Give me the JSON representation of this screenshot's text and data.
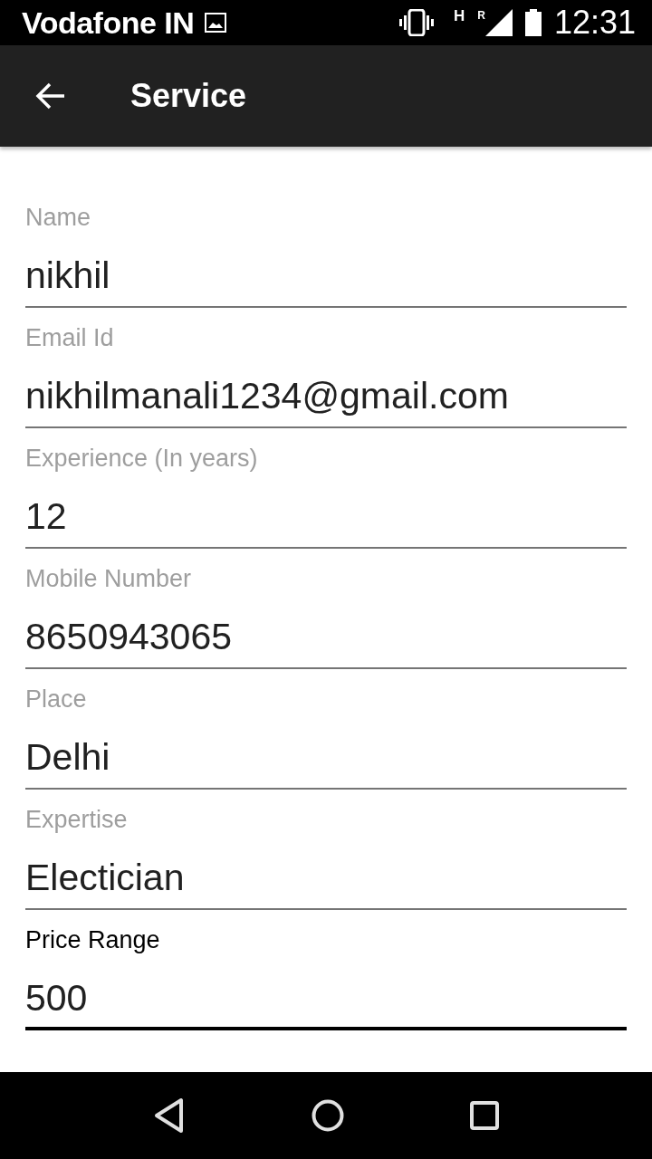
{
  "status_bar": {
    "carrier": "Vodafone IN",
    "network_type": "H",
    "roaming": "R",
    "time": "12:31"
  },
  "app_bar": {
    "title": "Service"
  },
  "fields": [
    {
      "label": "Name",
      "value": "nikhil",
      "focused": false
    },
    {
      "label": "Email Id",
      "value": "nikhilmanali1234@gmail.com",
      "focused": false
    },
    {
      "label": "Experience (In years)",
      "value": "12",
      "focused": false
    },
    {
      "label": "Mobile Number",
      "value": "8650943065",
      "focused": false
    },
    {
      "label": "Place",
      "value": "Delhi",
      "focused": false
    },
    {
      "label": "Expertise",
      "value": "Electician",
      "focused": false
    },
    {
      "label": "Price Range",
      "value": "500",
      "focused": true
    }
  ]
}
